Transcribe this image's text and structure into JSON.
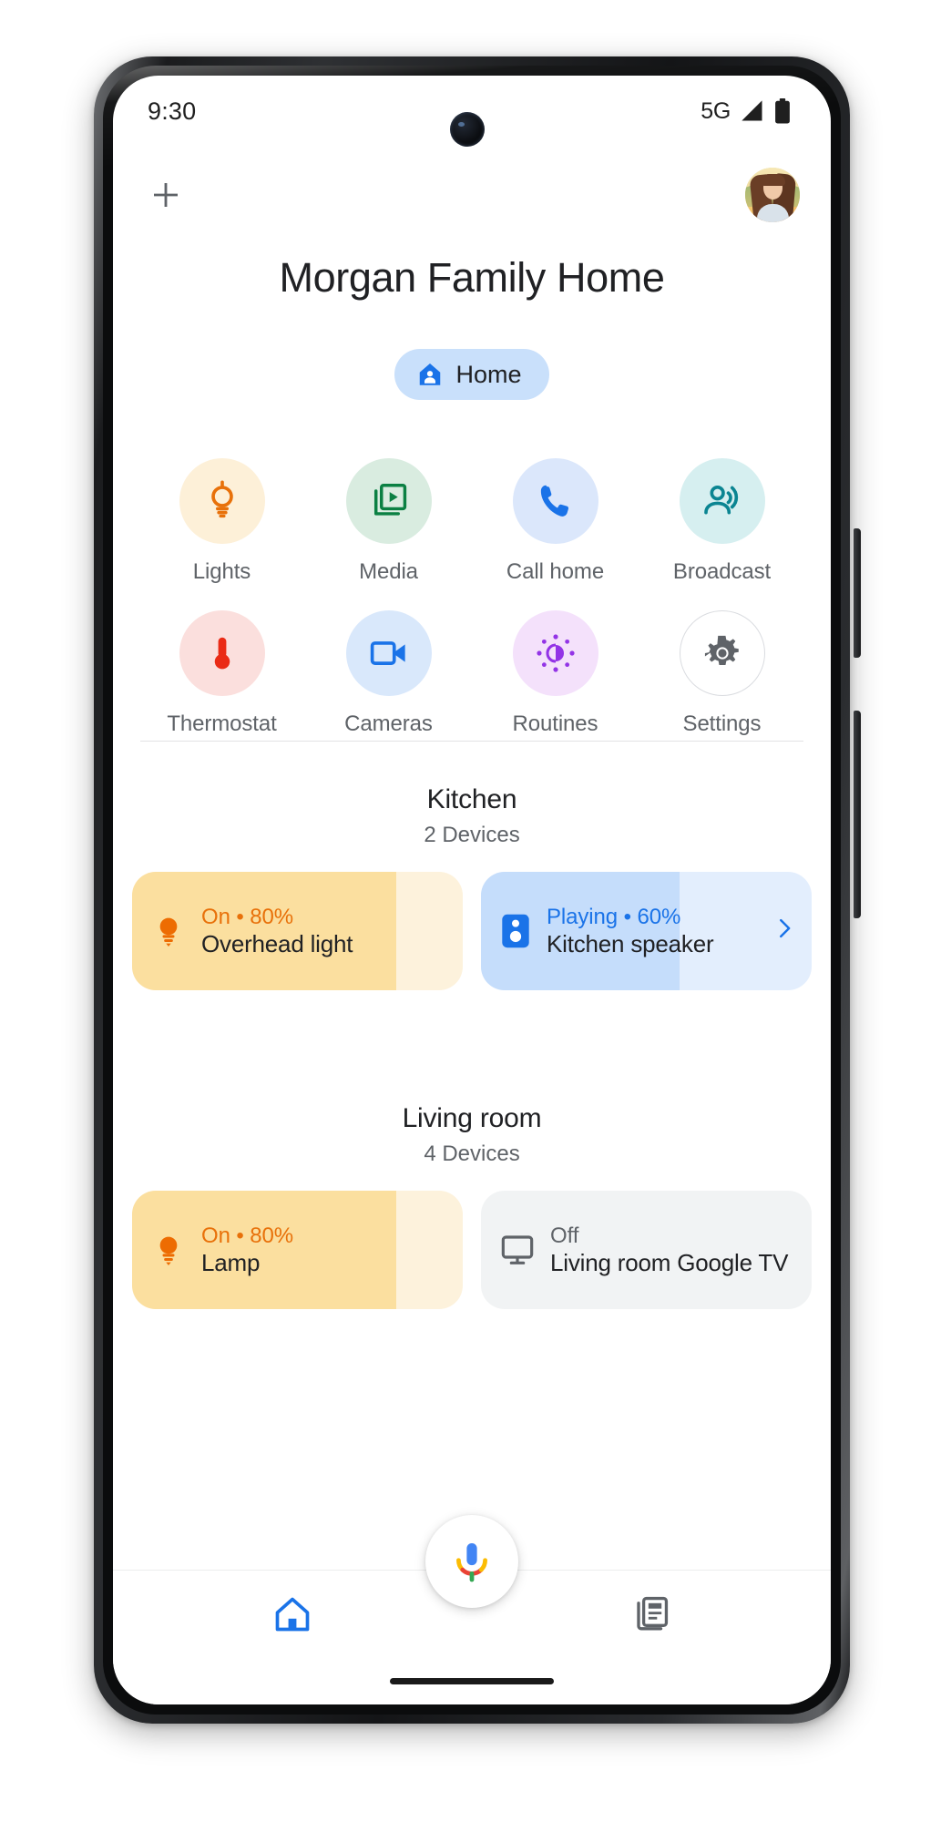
{
  "status_bar": {
    "time": "9:30",
    "network": "5G",
    "signal_icon": "signal-bars-icon",
    "battery_icon": "battery-full-icon"
  },
  "app_bar": {
    "add_icon": "plus-icon",
    "avatar_name": "account-avatar"
  },
  "header": {
    "title": "Morgan Family Home",
    "chip": {
      "label": "Home",
      "icon": "home-person-icon",
      "bg_color": "#c9e0fb",
      "icon_color": "#1a73e8"
    }
  },
  "quick_actions": [
    {
      "label": "Lights",
      "icon": "lightbulb-icon",
      "bg": "#fdf0d8",
      "fg": "#e8710a",
      "bordered": false
    },
    {
      "label": "Media",
      "icon": "media-play-icon",
      "bg": "#d9ece0",
      "fg": "#0b8043",
      "bordered": false
    },
    {
      "label": "Call home",
      "icon": "phone-icon",
      "bg": "#dbe7fb",
      "fg": "#1a73e8",
      "bordered": false
    },
    {
      "label": "Broadcast",
      "icon": "broadcast-icon",
      "bg": "#d6eff0",
      "fg": "#0b8592",
      "bordered": false
    },
    {
      "label": "Thermostat",
      "icon": "thermometer-icon",
      "bg": "#fbdfdd",
      "fg": "#ea2b16",
      "bordered": false
    },
    {
      "label": "Cameras",
      "icon": "video-camera-icon",
      "bg": "#d9e8fb",
      "fg": "#1a73e8",
      "bordered": false
    },
    {
      "label": "Routines",
      "icon": "routines-sun-icon",
      "bg": "#f4e1fb",
      "fg": "#9334e6",
      "bordered": false
    },
    {
      "label": "Settings",
      "icon": "gear-icon",
      "bg": "#ffffff",
      "fg": "#5f6368",
      "bordered": true
    }
  ],
  "rooms": [
    {
      "name": "Kitchen",
      "device_count": "2 Devices",
      "devices": [
        {
          "name": "Overhead light",
          "status": "On • 80%",
          "icon": "lightbulb-filled-icon",
          "fill_percent": 80,
          "track_color": "#fdf2dc",
          "fill_color": "#fbdf9f",
          "status_color": "#e8710a",
          "icon_color": "#ed6c02",
          "has_chevron": false
        },
        {
          "name": "Kitchen speaker",
          "status": "Playing • 60%",
          "icon": "speaker-icon",
          "fill_percent": 60,
          "track_color": "#e3eefd",
          "fill_color": "#c5ddfb",
          "status_color": "#1a73e8",
          "icon_color": "#1a73e8",
          "has_chevron": true,
          "chevron_icon": "chevron-right-icon"
        }
      ]
    },
    {
      "name": "Living room",
      "device_count": "4 Devices",
      "devices": [
        {
          "name": "Lamp",
          "status": "On • 80%",
          "icon": "lightbulb-filled-icon",
          "fill_percent": 80,
          "track_color": "#fdf2dc",
          "fill_color": "#fbdf9f",
          "status_color": "#e8710a",
          "icon_color": "#ed6c02",
          "has_chevron": false
        },
        {
          "name": "Living room Google TV",
          "status": "Off",
          "icon": "tv-monitor-icon",
          "fill_percent": 0,
          "track_color": "#f1f3f4",
          "fill_color": "#f1f3f4",
          "status_color": "#5f6368",
          "icon_color": "#5f6368",
          "has_chevron": false
        }
      ]
    }
  ],
  "assistant": {
    "mic_icon": "google-assistant-mic-icon"
  },
  "bottom_nav": [
    {
      "label": "Home",
      "icon": "home-icon",
      "active": true,
      "color": "#1a73e8"
    },
    {
      "label": "Feed",
      "icon": "feed-icon",
      "active": false,
      "color": "#5f6368"
    }
  ]
}
